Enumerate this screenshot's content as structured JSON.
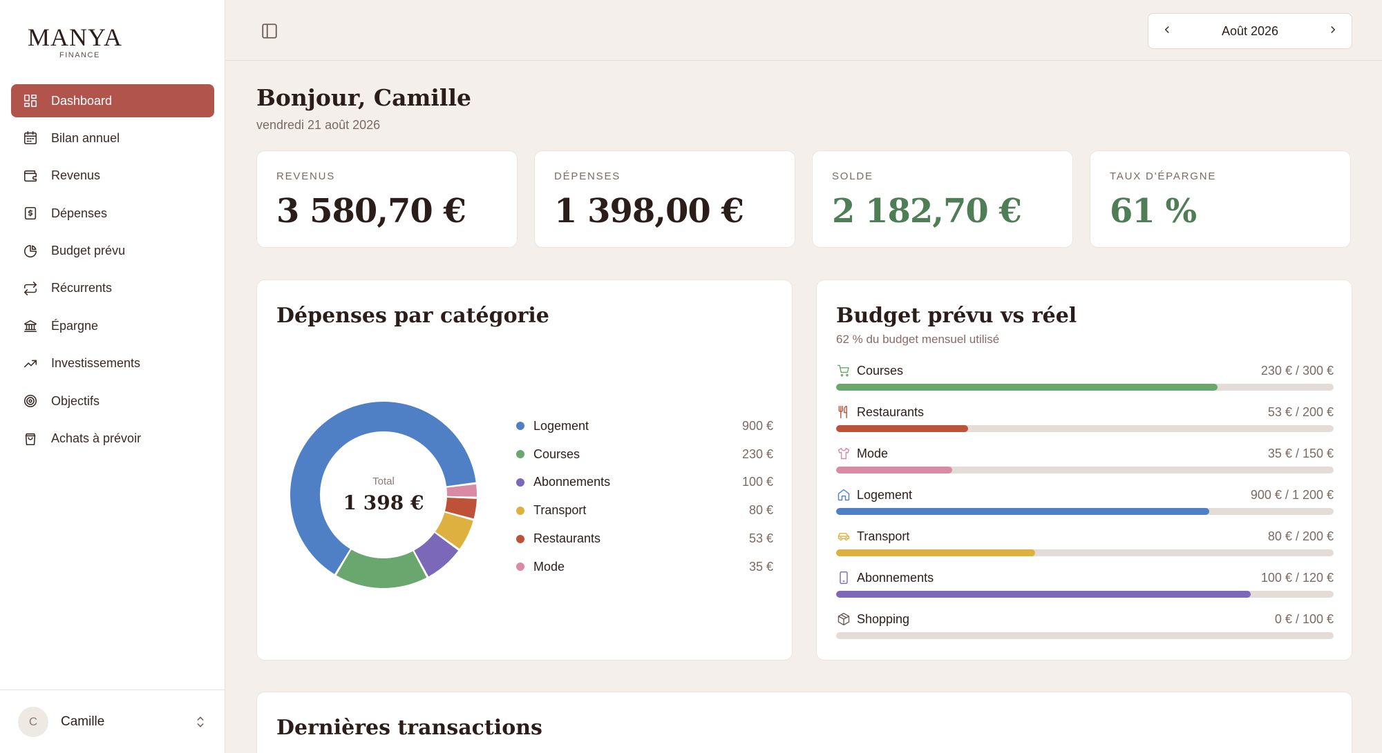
{
  "brand": {
    "name": "MANYA",
    "sub": "FINANCE"
  },
  "sidebar": {
    "items": [
      {
        "label": "Dashboard",
        "icon": "dashboard-icon",
        "active": true
      },
      {
        "label": "Bilan annuel",
        "icon": "calendar-icon"
      },
      {
        "label": "Revenus",
        "icon": "wallet-icon"
      },
      {
        "label": "Dépenses",
        "icon": "receipt-icon"
      },
      {
        "label": "Budget prévu",
        "icon": "pie-chart-icon"
      },
      {
        "label": "Récurrents",
        "icon": "repeat-icon"
      },
      {
        "label": "Épargne",
        "icon": "bank-icon"
      },
      {
        "label": "Investissements",
        "icon": "trending-up-icon"
      },
      {
        "label": "Objectifs",
        "icon": "target-icon"
      },
      {
        "label": "Achats à prévoir",
        "icon": "shopping-bag-icon"
      }
    ],
    "user": {
      "initial": "C",
      "name": "Camille"
    }
  },
  "topbar": {
    "month": "Août 2026"
  },
  "greeting": {
    "title": "Bonjour, Camille",
    "date": "vendredi 21 août 2026"
  },
  "kpis": [
    {
      "label": "REVENUS",
      "value": "3 580,70 €"
    },
    {
      "label": "DÉPENSES",
      "value": "1 398,00 €"
    },
    {
      "label": "SOLDE",
      "value": "2 182,70 €"
    },
    {
      "label": "TAUX D'ÉPARGNE",
      "value": "61 %"
    }
  ],
  "expenses_panel": {
    "title": "Dépenses par catégorie",
    "total_label": "Total",
    "total_value": "1 398 €",
    "categories": [
      {
        "label": "Logement",
        "value": "900 €",
        "amount": 900,
        "color": "#4f80c6"
      },
      {
        "label": "Courses",
        "value": "230 €",
        "amount": 230,
        "color": "#6aa76e"
      },
      {
        "label": "Abonnements",
        "value": "100 €",
        "amount": 100,
        "color": "#7b68b8"
      },
      {
        "label": "Transport",
        "value": "80 €",
        "amount": 80,
        "color": "#ddb040"
      },
      {
        "label": "Restaurants",
        "value": "53 €",
        "amount": 53,
        "color": "#bd5238"
      },
      {
        "label": "Mode",
        "value": "35 €",
        "amount": 35,
        "color": "#d98aa5"
      }
    ]
  },
  "budget_panel": {
    "title": "Budget prévu vs réel",
    "subtitle": "62 % du budget mensuel utilisé",
    "items": [
      {
        "label": "Courses",
        "amount": "230 € / 300 €",
        "spent": 230,
        "budget": 300,
        "color": "#6aa76e",
        "icon": "cart-icon"
      },
      {
        "label": "Restaurants",
        "amount": "53 € / 200 €",
        "spent": 53,
        "budget": 200,
        "color": "#bd5238",
        "icon": "utensils-icon"
      },
      {
        "label": "Mode",
        "amount": "35 € / 150 €",
        "spent": 35,
        "budget": 150,
        "color": "#d98aa5",
        "icon": "shirt-icon"
      },
      {
        "label": "Logement",
        "amount": "900 € / 1 200 €",
        "spent": 900,
        "budget": 1200,
        "color": "#4f80c6",
        "icon": "home-icon"
      },
      {
        "label": "Transport",
        "amount": "80 € / 200 €",
        "spent": 80,
        "budget": 200,
        "color": "#ddb040",
        "icon": "car-icon"
      },
      {
        "label": "Abonnements",
        "amount": "100 € / 120 €",
        "spent": 100,
        "budget": 120,
        "color": "#7b68b8",
        "icon": "smartphone-icon"
      },
      {
        "label": "Shopping",
        "amount": "0 € / 100 €",
        "spent": 0,
        "budget": 100,
        "color": "#7a6a63",
        "icon": "package-icon"
      }
    ]
  },
  "transactions_panel": {
    "title": "Dernières transactions"
  }
}
